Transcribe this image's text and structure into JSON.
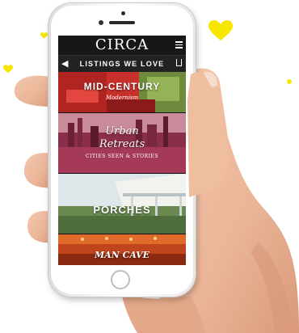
{
  "app": {
    "logo": "CIRCA",
    "subbar_title": "LISTINGS WE LOVE"
  },
  "icons": {
    "menu": "hamburger-menu-icon",
    "back": "chevron-left-icon",
    "share": "share-icon",
    "decor": "heart-icon"
  },
  "back_glyph": "◀",
  "listings": [
    {
      "title": "MID-CENTURY",
      "subtitle": "Modernism"
    },
    {
      "title_line1": "Urban",
      "title_line2": "Retreats",
      "subtitle": "CITIES SEEN & STORIES"
    },
    {
      "title": "PORCHES"
    },
    {
      "title": "MAN CAVE"
    }
  ],
  "colors": {
    "accent_yellow": "#f7e600",
    "header_bg": "#171717",
    "listing1": "#c8302c",
    "listing2": "#8a2f4a",
    "listing3": "#6b8a52",
    "listing4": "#c0441c"
  }
}
